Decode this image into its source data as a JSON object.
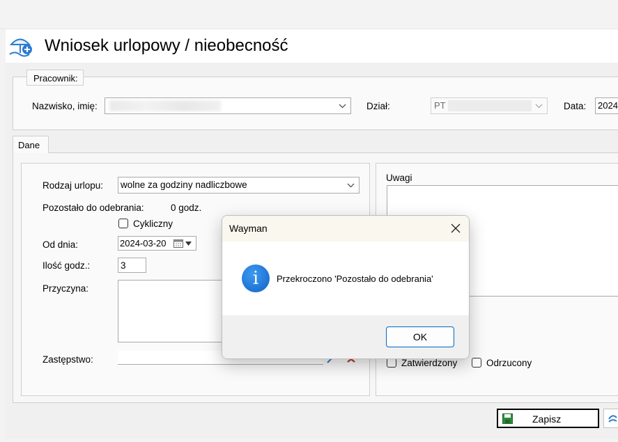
{
  "window": {
    "title": "Wniosek urlopowy / nieobecność"
  },
  "employee": {
    "legend": "Pracownik:",
    "name_label": "Nazwisko, imię:",
    "dept_label": "Dział:",
    "dept_value": "PT",
    "date_label": "Data:",
    "date_value": "2024"
  },
  "tabs": [
    {
      "label": "Dane"
    }
  ],
  "form": {
    "leave_type_label": "Rodzaj urlopu:",
    "leave_type_value": "wolne za godziny nadliczbowe",
    "remaining_label": "Pozostało do odebrania:",
    "remaining_value": "0 godz.",
    "cyclic_label": "Cykliczny",
    "from_label": "Od dnia:",
    "from_value": "2024-03-20",
    "hours_label": "Ilość godz.:",
    "hours_value": "3",
    "reason_label": "Przyczyna:",
    "substitute_label": "Zastępstwo:"
  },
  "notes": {
    "label": "Uwagi",
    "approved_label": "Zatwierdzony",
    "rejected_label": "Odrzucony"
  },
  "footer": {
    "save_label": "Zapisz"
  },
  "dialog": {
    "title": "Wayman",
    "message": "Przekroczono 'Pozostało do odebrania'",
    "ok_label": "OK"
  },
  "colors": {
    "accent": "#0067c0",
    "info_icon": "#1a73d9",
    "save_icon": "#2e8b3a",
    "delete_icon": "#c0392b"
  }
}
